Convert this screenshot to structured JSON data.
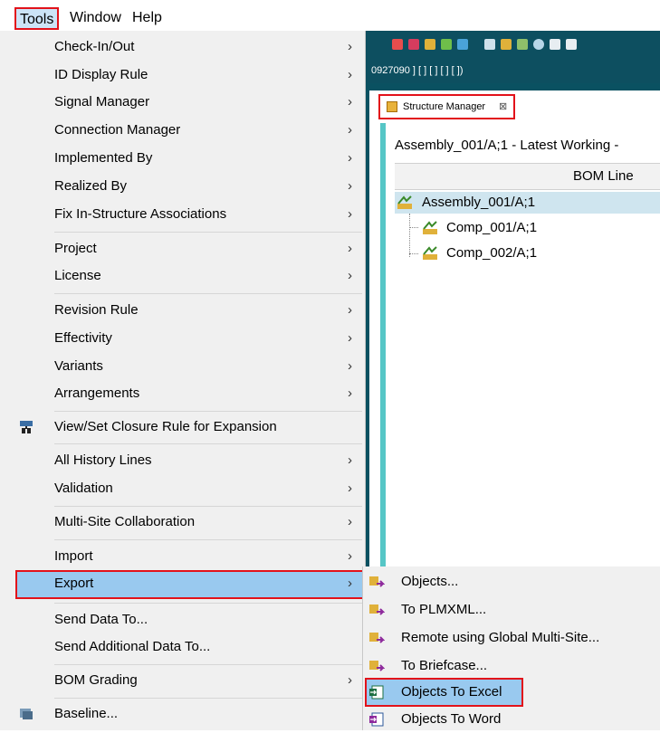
{
  "menubar": {
    "items": [
      {
        "label": "Tools",
        "selected": true
      },
      {
        "label": "Window"
      },
      {
        "label": "Help"
      }
    ]
  },
  "background": {
    "id_display": "0927090 ] [ ] [ ] [ ] [ ])",
    "tab_label": "Structure Manager",
    "tab_close": "⊠",
    "content_title": "Assembly_001/A;1 - Latest Working -",
    "column_header": "BOM Line",
    "tree": [
      {
        "label": "Assembly_001/A;1",
        "selected": true,
        "level": 0
      },
      {
        "label": "Comp_001/A;1",
        "level": 1
      },
      {
        "label": "Comp_002/A;1",
        "level": 1
      }
    ]
  },
  "tools_menu": {
    "items": [
      {
        "label": "Check-In/Out",
        "submenu": true
      },
      {
        "label": "ID Display Rule",
        "submenu": true
      },
      {
        "label": "Signal Manager",
        "submenu": true
      },
      {
        "label": "Connection Manager",
        "submenu": true
      },
      {
        "label": "Implemented By",
        "submenu": true
      },
      {
        "label": "Realized By",
        "submenu": true
      },
      {
        "label": "Fix In-Structure Associations",
        "submenu": true
      },
      {
        "label": "Project",
        "submenu": true
      },
      {
        "label": "License",
        "submenu": true
      },
      {
        "label": "Revision Rule",
        "submenu": true
      },
      {
        "label": "Effectivity",
        "submenu": true
      },
      {
        "label": "Variants",
        "submenu": true
      },
      {
        "label": "Arrangements",
        "submenu": true
      },
      {
        "label": "View/Set Closure Rule for Expansion",
        "icon": "closure-rule-icon"
      },
      {
        "label": "All History Lines",
        "submenu": true
      },
      {
        "label": "Validation",
        "submenu": true
      },
      {
        "label": "Multi-Site Collaboration",
        "submenu": true
      },
      {
        "label": "Import",
        "submenu": true
      },
      {
        "label": "Export",
        "submenu": true,
        "highlighted": true
      },
      {
        "label": "Send Data To..."
      },
      {
        "label": "Send Additional Data To..."
      },
      {
        "label": "BOM Grading",
        "submenu": true
      },
      {
        "label": "Baseline...",
        "icon": "baseline-icon"
      }
    ],
    "arrow": "›"
  },
  "export_submenu": {
    "items": [
      {
        "label": "Objects...",
        "icon": "export-objects-icon"
      },
      {
        "label": "To PLMXML...",
        "icon": "export-plmxml-icon"
      },
      {
        "label": "Remote using Global Multi-Site...",
        "icon": "export-remote-icon"
      },
      {
        "label": "To Briefcase...",
        "icon": "export-briefcase-icon"
      },
      {
        "label": "Objects To Excel",
        "icon": "excel-icon",
        "highlighted": true
      },
      {
        "label": "Objects To Word",
        "icon": "word-icon"
      }
    ]
  },
  "colors": {
    "highlight": "#99c9ef",
    "annotation_red": "#e2121a",
    "app_teal": "#0a5161",
    "tree_selection": "#cfe5ef"
  }
}
